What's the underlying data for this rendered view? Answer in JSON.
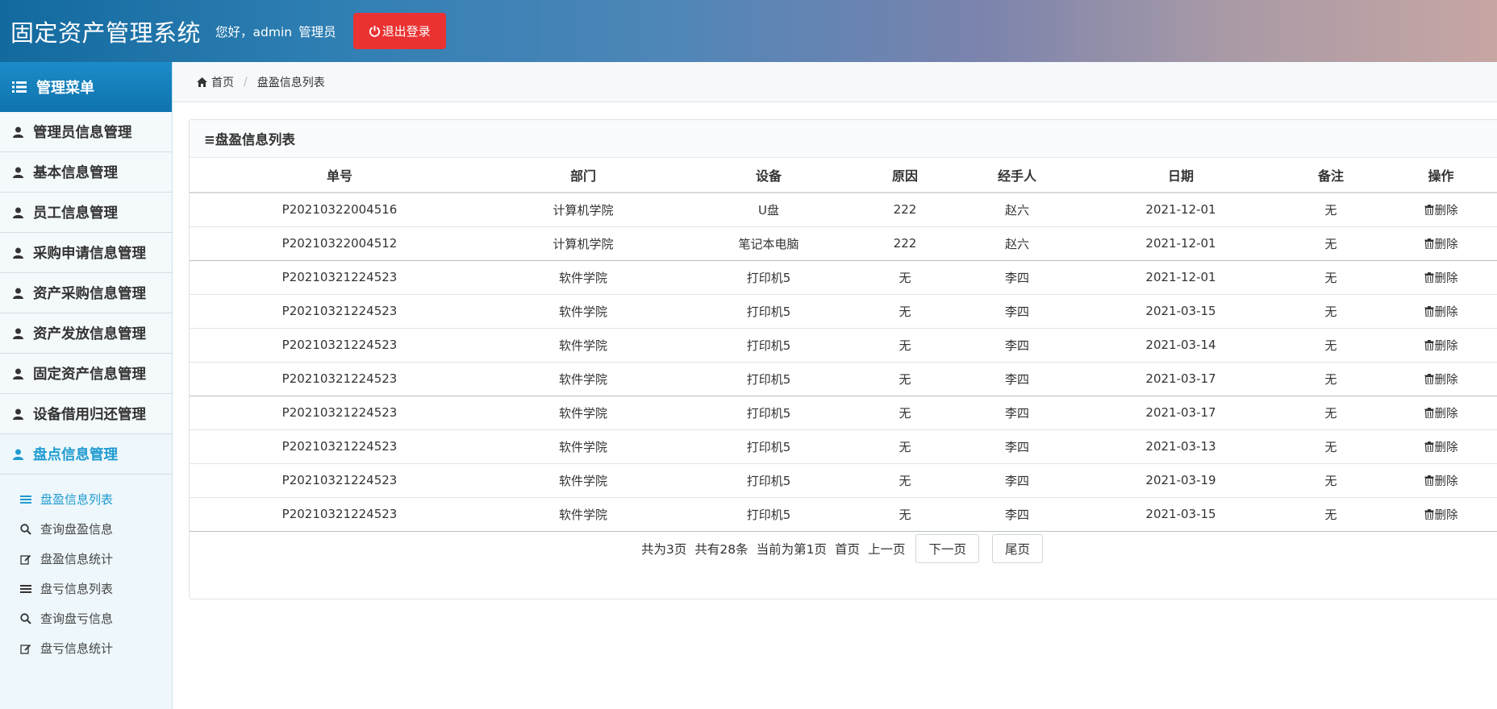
{
  "header": {
    "title": "固定资产管理系统",
    "greeting": "您好，admin",
    "role": "管理员",
    "logout_label": "退出登录"
  },
  "sidebar": {
    "menu_title": "管理菜单",
    "items": [
      {
        "label": "管理员信息管理"
      },
      {
        "label": "基本信息管理"
      },
      {
        "label": "员工信息管理"
      },
      {
        "label": "采购申请信息管理"
      },
      {
        "label": "资产采购信息管理"
      },
      {
        "label": "资产发放信息管理"
      },
      {
        "label": "固定资产信息管理"
      },
      {
        "label": "设备借用归还管理"
      },
      {
        "label": "盘点信息管理"
      }
    ],
    "submenu": [
      {
        "label": "盘盈信息列表",
        "icon": "list-icon"
      },
      {
        "label": "查询盘盈信息",
        "icon": "search-icon"
      },
      {
        "label": "盘盈信息统计",
        "icon": "edit-icon"
      },
      {
        "label": "盘亏信息列表",
        "icon": "list-icon"
      },
      {
        "label": "查询盘亏信息",
        "icon": "search-icon"
      },
      {
        "label": "盘亏信息统计",
        "icon": "edit-icon"
      }
    ]
  },
  "breadcrumb": {
    "home": "首页",
    "current": "盘盈信息列表"
  },
  "panel": {
    "title": "≡盘盈信息列表"
  },
  "table": {
    "headers": [
      "单号",
      "部门",
      "设备",
      "原因",
      "经手人",
      "日期",
      "备注",
      "操作"
    ],
    "delete_label": "删除",
    "rows": [
      [
        "P20210322004516",
        "计算机学院",
        "U盘",
        "222",
        "赵六",
        "2021-12-01",
        "无"
      ],
      [
        "P20210322004512",
        "计算机学院",
        "笔记本电脑",
        "222",
        "赵六",
        "2021-12-01",
        "无"
      ],
      [
        "P20210321224523",
        "软件学院",
        "打印机5",
        "无",
        "李四",
        "2021-12-01",
        "无"
      ],
      [
        "P20210321224523",
        "软件学院",
        "打印机5",
        "无",
        "李四",
        "2021-03-15",
        "无"
      ],
      [
        "P20210321224523",
        "软件学院",
        "打印机5",
        "无",
        "李四",
        "2021-03-14",
        "无"
      ],
      [
        "P20210321224523",
        "软件学院",
        "打印机5",
        "无",
        "李四",
        "2021-03-17",
        "无"
      ],
      [
        "P20210321224523",
        "软件学院",
        "打印机5",
        "无",
        "李四",
        "2021-03-17",
        "无"
      ],
      [
        "P20210321224523",
        "软件学院",
        "打印机5",
        "无",
        "李四",
        "2021-03-13",
        "无"
      ],
      [
        "P20210321224523",
        "软件学院",
        "打印机5",
        "无",
        "李四",
        "2021-03-19",
        "无"
      ],
      [
        "P20210321224523",
        "软件学院",
        "打印机5",
        "无",
        "李四",
        "2021-03-15",
        "无"
      ]
    ]
  },
  "pager": {
    "total_pages": "共为3页",
    "total_records": "共有28条",
    "current_page": "当前为第1页",
    "first": "首页",
    "prev": "上一页",
    "next": "下一页",
    "last": "尾页"
  },
  "colors": {
    "logout": "#ea3232",
    "accent": "#1f9bd1",
    "menu_head": "#137fbd"
  }
}
